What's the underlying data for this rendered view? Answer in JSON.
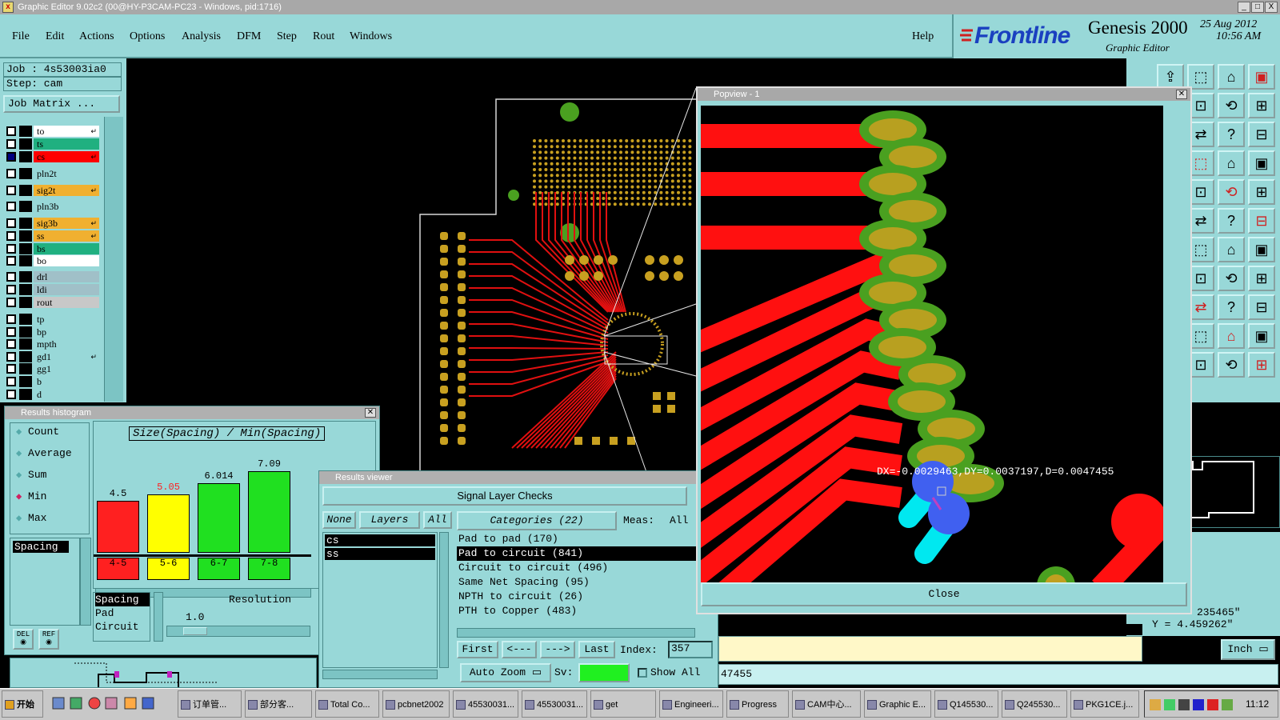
{
  "window": {
    "title": "Graphic Editor 9.02c2 (00@HY-P3CAM-PC23 - Windows, pid:1716)",
    "min": "_",
    "max": "□",
    "close": "X"
  },
  "menu": {
    "items": [
      "File",
      "Edit",
      "Actions",
      "Options",
      "Analysis",
      "DFM",
      "Step",
      "Rout",
      "Windows"
    ],
    "help": "Help"
  },
  "brand": {
    "logo": "Frontline",
    "product": "Genesis 2000",
    "subtitle": "Graphic Editor",
    "date": "25 Aug 2012",
    "time": "10:56 AM"
  },
  "job": {
    "job_label": "Job : 4s53003ia0",
    "step_label": "Step: cam",
    "matrix_button": "Job Matrix ..."
  },
  "layers": [
    {
      "name": "to",
      "color": "#ffffff",
      "mark": "↵",
      "checked": false
    },
    {
      "name": "ts",
      "color": "#20b080",
      "mark": "",
      "checked": false
    },
    {
      "name": "cs",
      "color": "#ff0000",
      "mark": "↵",
      "checked": true
    },
    {
      "name": "pln2t",
      "color": "#98d8d8",
      "mark": "",
      "checked": false
    },
    {
      "name": "sig2t",
      "color": "#f0b030",
      "mark": "↵",
      "checked": false
    },
    {
      "name": "pln3b",
      "color": "#98d8d8",
      "mark": "",
      "checked": false
    },
    {
      "name": "sig3b",
      "color": "#f0b030",
      "mark": "↵",
      "checked": false
    },
    {
      "name": "ss",
      "color": "#f0b030",
      "mark": "↵",
      "checked": false
    },
    {
      "name": "bs",
      "color": "#20b080",
      "mark": "",
      "checked": false
    },
    {
      "name": "bo",
      "color": "#ffffff",
      "mark": "",
      "checked": false
    },
    {
      "name": "drl",
      "color": "#a0c0c8",
      "mark": "",
      "checked": false
    },
    {
      "name": "ldi",
      "color": "#a0c0c8",
      "mark": "",
      "checked": false
    },
    {
      "name": "rout",
      "color": "#c8c8c8",
      "mark": "",
      "checked": false
    },
    {
      "name": "tp",
      "color": "#98d8d8",
      "mark": "",
      "checked": false
    },
    {
      "name": "bp",
      "color": "#98d8d8",
      "mark": "",
      "checked": false
    },
    {
      "name": "mpth",
      "color": "#98d8d8",
      "mark": "",
      "checked": false
    },
    {
      "name": "gd1",
      "color": "#98d8d8",
      "mark": "↵",
      "checked": false
    },
    {
      "name": "gg1",
      "color": "#98d8d8",
      "mark": "",
      "checked": false
    },
    {
      "name": "b",
      "color": "#98d8d8",
      "mark": "",
      "checked": false
    },
    {
      "name": "d",
      "color": "#98d8d8",
      "mark": "",
      "checked": false
    }
  ],
  "histogram": {
    "title": "Results histogram",
    "options": [
      {
        "label": "Count",
        "active": false
      },
      {
        "label": "Average",
        "active": false
      },
      {
        "label": "Sum",
        "active": false
      },
      {
        "label": "Min",
        "active": true
      },
      {
        "label": "Max",
        "active": false
      }
    ],
    "metric_selected": "Spacing",
    "del_label": "DEL",
    "ref_label": "REF",
    "list": [
      "Spacing",
      "Pad",
      "Circuit"
    ],
    "resolution_label": "Resolution",
    "resolution_value": "1.0"
  },
  "chart_data": {
    "type": "bar",
    "title": "Size(Spacing) / Min(Spacing)",
    "categories": [
      "4-5",
      "5-6",
      "6-7",
      "7-8"
    ],
    "values": [
      4.5,
      5.05,
      6.014,
      7.09
    ],
    "value_labels": [
      "4.5",
      "5.05",
      "6.014",
      "7.09"
    ],
    "colors": [
      "#ff2020",
      "#ffff00",
      "#20e020",
      "#20e020"
    ],
    "value_label_colors": [
      "#000000",
      "#ff2020",
      "#000000",
      "#000000"
    ],
    "ylim": [
      0,
      7.09
    ]
  },
  "results": {
    "title": "Results viewer",
    "header": "Signal Layer Checks",
    "none_btn": "None",
    "layers_btn": "Layers",
    "all_btn": "All",
    "layers": [
      "cs",
      "ss"
    ],
    "categories_label": "Categories (22)",
    "meas_label": "Meas:",
    "meas_value": "All",
    "categories": [
      "Pad to pad (170)",
      "Pad to circuit (841)",
      "Circuit to circuit (496)",
      "Same Net Spacing (95)",
      "NPTH to circuit (26)",
      "PTH to Copper (483)"
    ],
    "selected_category": 1,
    "first": "First",
    "prev": "<---",
    "next": "--->",
    "last": "Last",
    "index_label": "Index:",
    "index_value": "357",
    "zoom": "Auto Zoom",
    "sv_label": "Sv:",
    "show_all": "Show All"
  },
  "popview": {
    "title": "Popview - 1",
    "measure": "DX=-0.0029463,DY=0.0037197,D=0.0047455",
    "close": "Close"
  },
  "status": {
    "x_tail": "235465\"",
    "y_coord": "Y = 4.459262\"",
    "units": "Inch",
    "d_value": "47455"
  },
  "taskbar": {
    "start": "开始",
    "items": [
      "订单管...",
      "部分客...",
      "Total Co...",
      "pcbnet2002",
      "45530031...",
      "45530031...",
      "get",
      "Engineeri...",
      "Progress",
      "CAM中心...",
      "Graphic E...",
      "Q145530...",
      "Q245530...",
      "PKG1CE.j..."
    ],
    "clock": "11:12"
  }
}
